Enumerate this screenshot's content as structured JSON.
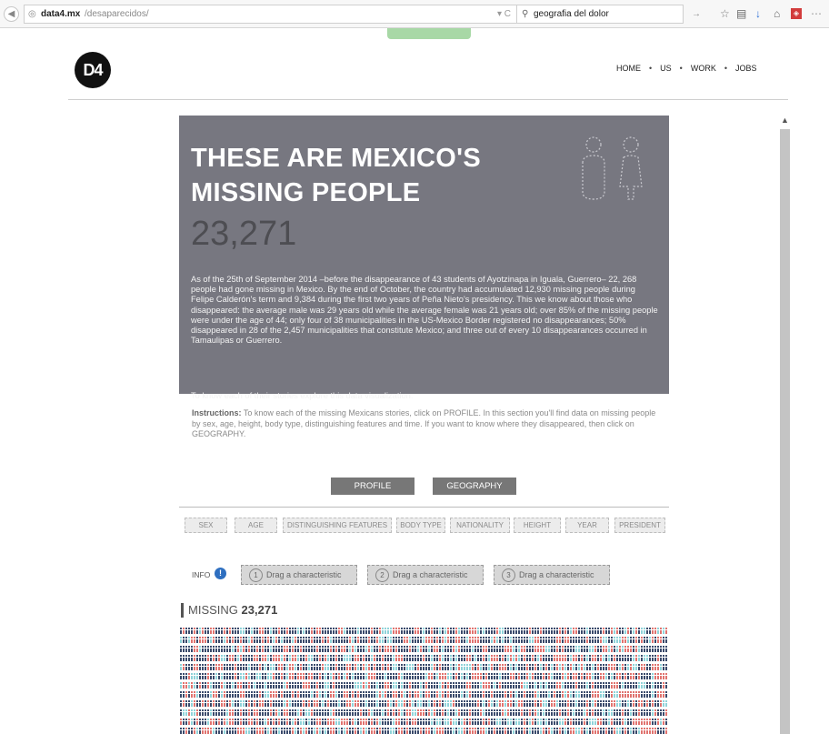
{
  "browser": {
    "url_host": "data4.mx",
    "url_path": "/desaparecidos/",
    "search_query": "geografia del dolor"
  },
  "site": {
    "logo": "D4",
    "nav": [
      "HOME",
      "US",
      "WORK",
      "JOBS"
    ]
  },
  "hero": {
    "title_line1": "THESE ARE MEXICO'S",
    "title_line2": "MISSING PEOPLE",
    "count": "23,271",
    "body": "As of the 25th of September 2014 –before the disappearance of 43 students of Ayotzinapa in Iguala, Guerrero– 22, 268 people had gone missing in Mexico. By the end of October, the country had accumulated 12,930 missing people during Felipe Calderón's term and 9,384 during the first two years of Peña Nieto's presidency. This we know about those who disappeared: the average male was 29 years old while the average female was 21 years old; over 85% of the missing people were under the age of 44; only four of 38 municipalities in the US-Mexico Border registered no disappearances; 50% disappeared in 28 of the 2,457 municipalities that constitute Mexico; and three out of every 10 disappearances occurred in Tamaulipas or Guerrero.",
    "cta": "To know each of their stories explore this data visualization."
  },
  "instructions": {
    "lead": "Instructions:",
    "text": " To know each of the missing Mexicans stories, click on PROFILE. In this section you'll find data on missing people by sex, age, height, body type, distinguishing features and time. If you want to know where they disappeared, then click on GEOGRAPHY."
  },
  "buttons": {
    "profile": "PROFILE",
    "geography": "GEOGRAPHY"
  },
  "characteristics": [
    "SEX",
    "AGE",
    "DISTINGUISHING FEATURES",
    "BODY TYPE",
    "NATIONALITY",
    "HEIGHT",
    "YEAR",
    "PRESIDENT"
  ],
  "info": {
    "label": "INFO",
    "icon": "!"
  },
  "drop_slots": [
    {
      "num": "1",
      "label": "Drag a characteristic"
    },
    {
      "num": "2",
      "label": "Drag a characteristic"
    },
    {
      "num": "3",
      "label": "Drag a characteristic"
    }
  ],
  "missing": {
    "label": "MISSING",
    "count": "23,271"
  },
  "colors": {
    "male": "#3a4a6b",
    "female": "#e0736f",
    "unknown": "#8fd3d9"
  }
}
